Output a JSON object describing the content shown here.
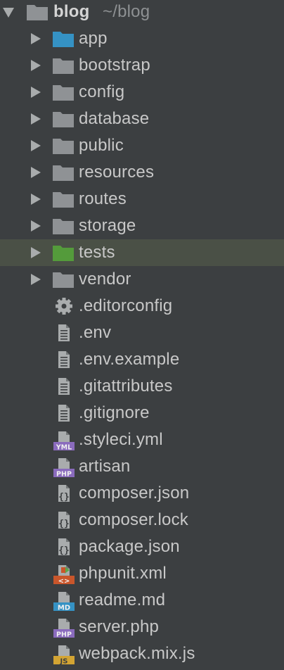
{
  "root": {
    "name": "blog",
    "path": "~/blog"
  },
  "folders": [
    {
      "name": "app",
      "color": "#3592c4"
    },
    {
      "name": "bootstrap",
      "color": "#8f9295"
    },
    {
      "name": "config",
      "color": "#8f9295"
    },
    {
      "name": "database",
      "color": "#8f9295"
    },
    {
      "name": "public",
      "color": "#8f9295"
    },
    {
      "name": "resources",
      "color": "#8f9295"
    },
    {
      "name": "routes",
      "color": "#8f9295"
    },
    {
      "name": "storage",
      "color": "#8f9295"
    },
    {
      "name": "tests",
      "color": "#549b3b",
      "selected": true
    },
    {
      "name": "vendor",
      "color": "#8f9295"
    }
  ],
  "files": [
    {
      "name": ".editorconfig",
      "icon": "gear-icon"
    },
    {
      "name": ".env",
      "icon": "text-file-icon"
    },
    {
      "name": ".env.example",
      "icon": "text-file-icon"
    },
    {
      "name": ".gitattributes",
      "icon": "text-file-icon"
    },
    {
      "name": ".gitignore",
      "icon": "text-file-icon"
    },
    {
      "name": ".styleci.yml",
      "icon": "yaml-file-icon",
      "badge": "YML",
      "badge_color": "#8a6bbd"
    },
    {
      "name": "artisan",
      "icon": "php-file-icon",
      "badge": "PHP",
      "badge_color": "#8a6bbd"
    },
    {
      "name": "composer.json",
      "icon": "json-file-icon"
    },
    {
      "name": "composer.lock",
      "icon": "json-file-icon"
    },
    {
      "name": "package.json",
      "icon": "json-file-icon"
    },
    {
      "name": "phpunit.xml",
      "icon": "xml-file-icon",
      "badge": "<>",
      "badge_color": "#c9562b"
    },
    {
      "name": "readme.md",
      "icon": "markdown-file-icon",
      "badge": "MD",
      "badge_color": "#3592c4"
    },
    {
      "name": "server.php",
      "icon": "php-file-icon",
      "badge": "PHP",
      "badge_color": "#8a6bbd"
    },
    {
      "name": "webpack.mix.js",
      "icon": "js-file-icon",
      "badge": "JS",
      "badge_color": "#d3a433"
    }
  ]
}
